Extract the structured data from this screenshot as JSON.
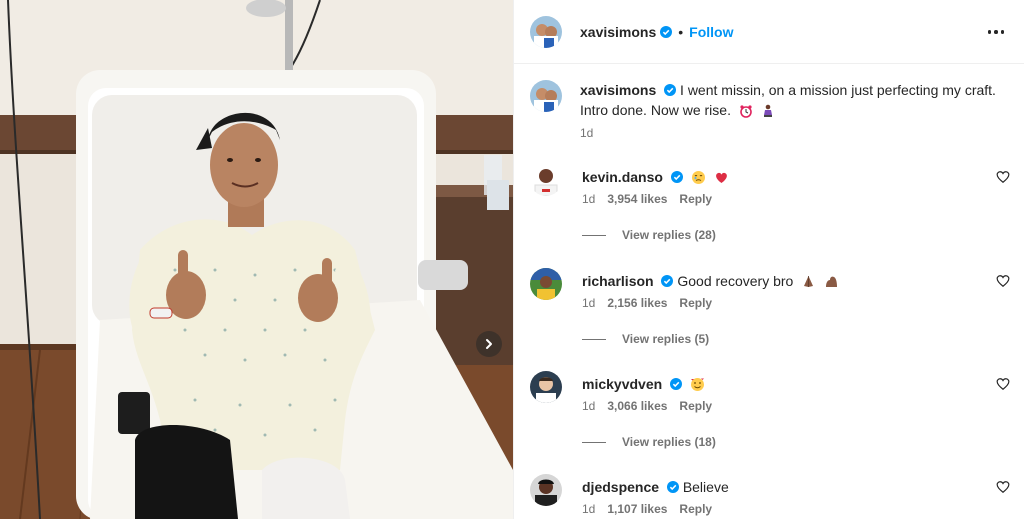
{
  "post": {
    "username": "xavisimons",
    "follow_label": "Follow",
    "dot": "•",
    "caption": "I went missin, on a mission just perfecting my craft. Intro done. Now we rise.",
    "caption_emojis": [
      "alarm-clock",
      "person-kneeling"
    ],
    "time": "1d"
  },
  "comments": [
    {
      "username": "kevin.danso",
      "text": "",
      "emojis": [
        "face-holding-back-tears",
        "red-heart"
      ],
      "time": "1d",
      "likes": "3,954 likes",
      "reply": "Reply",
      "view_replies": "View replies (28)"
    },
    {
      "username": "richarlison",
      "text": "Good recovery bro",
      "emojis": [
        "folded-hands",
        "flexed-biceps"
      ],
      "time": "1d",
      "likes": "2,156 likes",
      "reply": "Reply",
      "view_replies": "View replies (5)"
    },
    {
      "username": "mickyvdven",
      "text": "",
      "emojis": [
        "smiling-face-with-hearts"
      ],
      "time": "1d",
      "likes": "3,066 likes",
      "reply": "Reply",
      "view_replies": "View replies (18)"
    },
    {
      "username": "djedspence",
      "text": "Believe",
      "emojis": [],
      "time": "1d",
      "likes": "1,107 likes",
      "reply": "Reply",
      "view_replies": ""
    }
  ],
  "colors": {
    "accent": "#0095f6",
    "verified": "#0095f6",
    "text": "#262626",
    "secondary": "#737373",
    "divider": "#efefef"
  },
  "icons": {
    "more": "more-options-icon",
    "verified": "verified-badge-icon",
    "like": "heart-outline-icon",
    "next": "chevron-right-icon"
  }
}
